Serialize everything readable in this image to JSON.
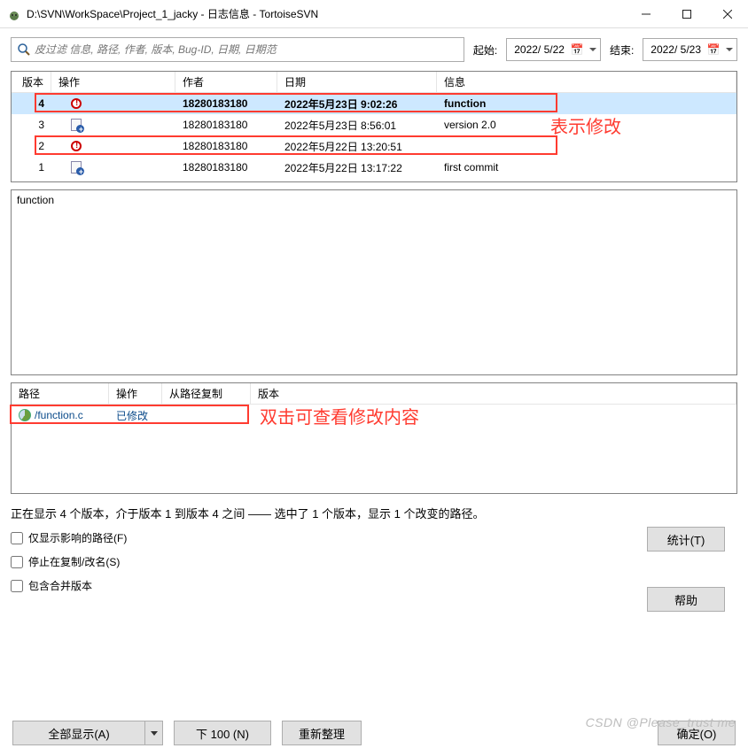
{
  "window": {
    "title": "D:\\SVN\\WorkSpace\\Project_1_jacky - 日志信息 - TortoiseSVN"
  },
  "filter": {
    "placeholder": "皮过滤 信息, 路径, 作者, 版本, Bug-ID, 日期, 日期范",
    "start_label": "起始:",
    "start_value": "2022/ 5/22",
    "end_label": "结束:",
    "end_value": "2022/ 5/23"
  },
  "log_columns": {
    "rev": "版本",
    "ops": "操作",
    "author": "作者",
    "date": "日期",
    "msg": "信息"
  },
  "log_rows": [
    {
      "rev": "4",
      "ops": "mod",
      "author": "18280183180",
      "date": "2022年5月23日 9:02:26",
      "msg": "function",
      "selected": true
    },
    {
      "rev": "3",
      "ops": "add",
      "author": "18280183180",
      "date": "2022年5月23日 8:56:01",
      "msg": "version 2.0"
    },
    {
      "rev": "2",
      "ops": "mod",
      "author": "18280183180",
      "date": "2022年5月22日 13:20:51",
      "msg": ""
    },
    {
      "rev": "1",
      "ops": "add",
      "author": "18280183180",
      "date": "2022年5月22日 13:17:22",
      "msg": "first commit"
    }
  ],
  "message_panel": "function",
  "path_columns": {
    "path": "路径",
    "op": "操作",
    "from": "从路径复制",
    "rev": "版本"
  },
  "path_rows": [
    {
      "path": "/function.c",
      "op": "已修改",
      "from": "",
      "rev": ""
    }
  ],
  "status_line": "正在显示 4 个版本，介于版本 1 到版本 4 之间 —— 选中了 1 个版本，显示 1 个改变的路径。",
  "checks": {
    "affected": "仅显示影响的路径(F)",
    "stop": "停止在复制/改名(S)",
    "merged": "包含合并版本"
  },
  "buttons": {
    "stats": "统计(T)",
    "help": "帮助",
    "show_all": "全部显示(A)",
    "next100": "下 100 (N)",
    "refresh": "重新整理",
    "ok": "确定(O)"
  },
  "annotations": {
    "mod_label": "表示修改",
    "dbl_label": "双击可查看修改内容"
  },
  "watermark": "CSDN @Please_trust me"
}
